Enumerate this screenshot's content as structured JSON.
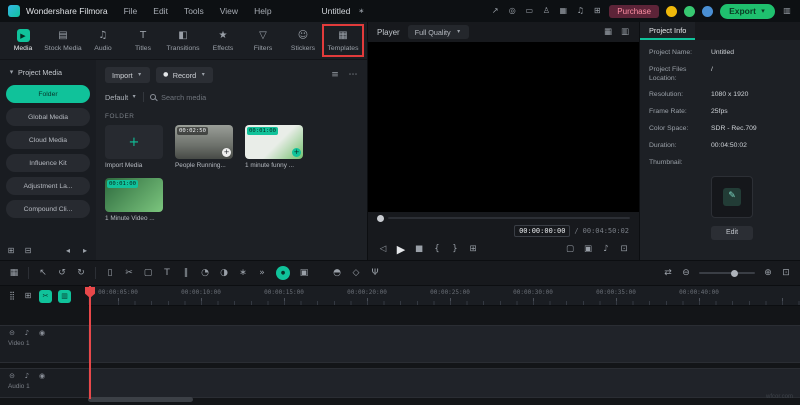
{
  "titlebar": {
    "app_name": "Wondershare Filmora",
    "menus": [
      {
        "label": "File"
      },
      {
        "label": "Edit"
      },
      {
        "label": "Tools"
      },
      {
        "label": "View"
      },
      {
        "label": "Help"
      }
    ],
    "project_title": "Untitled",
    "purchase_label": "Purchase",
    "export_label": "Export"
  },
  "tabs": [
    {
      "label": "Media",
      "active": true
    },
    {
      "label": "Stock Media"
    },
    {
      "label": "Audio"
    },
    {
      "label": "Titles"
    },
    {
      "label": "Transitions"
    },
    {
      "label": "Effects"
    },
    {
      "label": "Filters"
    },
    {
      "label": "Stickers"
    },
    {
      "label": "Templates",
      "highlighted": true
    }
  ],
  "sidebar": {
    "root_label": "Project Media",
    "items": [
      {
        "label": "Folder",
        "active": true
      },
      {
        "label": "Global Media"
      },
      {
        "label": "Cloud Media"
      },
      {
        "label": "Influence Kit"
      },
      {
        "label": "Adjustment La..."
      },
      {
        "label": "Compound Cli..."
      }
    ]
  },
  "browser": {
    "import_label": "Import",
    "record_label": "Record",
    "sort_label": "Default",
    "search_placeholder": "Search media",
    "section_label": "FOLDER",
    "cards": [
      {
        "label": "Import Media",
        "type": "import"
      },
      {
        "label": "People Running...",
        "duration": "00:02:50"
      },
      {
        "label": "1 minute funny ...",
        "duration": "00:01:00"
      },
      {
        "label": "1 Minute Video ...",
        "duration": "00:01:00"
      }
    ]
  },
  "player": {
    "label": "Player",
    "quality": "Full Quality",
    "current_time": "00:00:00:00",
    "separator": "/",
    "duration": "00:04:50:02"
  },
  "project_info": {
    "tab_label": "Project Info",
    "fields": [
      {
        "label": "Project Name:",
        "value": "Untitled"
      },
      {
        "label": "Project Files Location:",
        "value": "/"
      },
      {
        "label": "Resolution:",
        "value": "1080 x 1920"
      },
      {
        "label": "Frame Rate:",
        "value": "25fps"
      },
      {
        "label": "Color Space:",
        "value": "SDR - Rec.709"
      },
      {
        "label": "Duration:",
        "value": "00:04:50:02"
      },
      {
        "label": "Thumbnail:",
        "value": ""
      }
    ],
    "edit_label": "Edit"
  },
  "timeline": {
    "ruler_labels": [
      "00:00:05:00",
      "00:00:10:00",
      "00:00:15:00",
      "00:00:20:00",
      "00:00:25:00",
      "00:00:30:00",
      "00:00:35:00",
      "00:00:40:00"
    ],
    "tracks": [
      {
        "name": "Video 1"
      },
      {
        "name": "Audio 1"
      }
    ]
  },
  "watermark": "wfcor.com",
  "colors": {
    "accent": "#10c29a",
    "export": "#1fc06e",
    "purchase_bg": "#5d2438",
    "purchase_text": "#ff8fa3",
    "highlight": "#e23b3b",
    "playhead": "#e8484a",
    "badge_yellow": "#f0b90b",
    "badge_green": "#37c871",
    "badge_blue": "#4a8fd4"
  },
  "icons": {
    "chevron_down": "▾",
    "share": "↗",
    "bell": "◎",
    "device": "▭",
    "user": "♙",
    "layout": "▦",
    "resources": "♫",
    "shortcuts": "⊞",
    "panel_toggle": "▥",
    "project_menu": "∗",
    "media_play": "▶",
    "stock": "▤",
    "audio": "♫",
    "titles": "T",
    "transitions": "◧",
    "effects": "★",
    "filters": "▽",
    "stickers": "☺",
    "templates": "▦",
    "folder_caret": "▾",
    "add_folder": "⊞",
    "del_folder": "⊟",
    "nav_left": "◂",
    "nav_right": "▸",
    "record_dot": "●",
    "filter_list": "≡",
    "more": "⋯",
    "plus": "+",
    "grid_view": "▦",
    "detach": "▥",
    "step_back": "◁",
    "play": "▶",
    "stop": "■",
    "mark_in": "{",
    "mark_out": "}",
    "render_preview": "⊞",
    "crop": "▢",
    "snapshot": "▣",
    "volume": "♪",
    "fullscreen": "⊡",
    "pencil": "✎",
    "toolbar_menu": "▦",
    "cursor": "↖",
    "undo": "↺",
    "redo": "↻",
    "trash": "▯",
    "scissors": "✂",
    "text_tool": "T",
    "split": "‖",
    "speed": "◔",
    "color": "◑",
    "magic": "∗",
    "more_tools": "»",
    "ai_dot": "●",
    "screen_record": "▣",
    "mask": "◓",
    "keyframe": "◇",
    "mic": "Ψ",
    "ripple": "⇄",
    "zoom_out": "⊖",
    "zoom_in": "⊕",
    "fit": "⊡",
    "track_manage": "⣿",
    "add_track": "⊞",
    "quick_split": "✂",
    "quick_crop": "▥",
    "lock": "⊝",
    "mute": "♪",
    "eye": "◉"
  }
}
